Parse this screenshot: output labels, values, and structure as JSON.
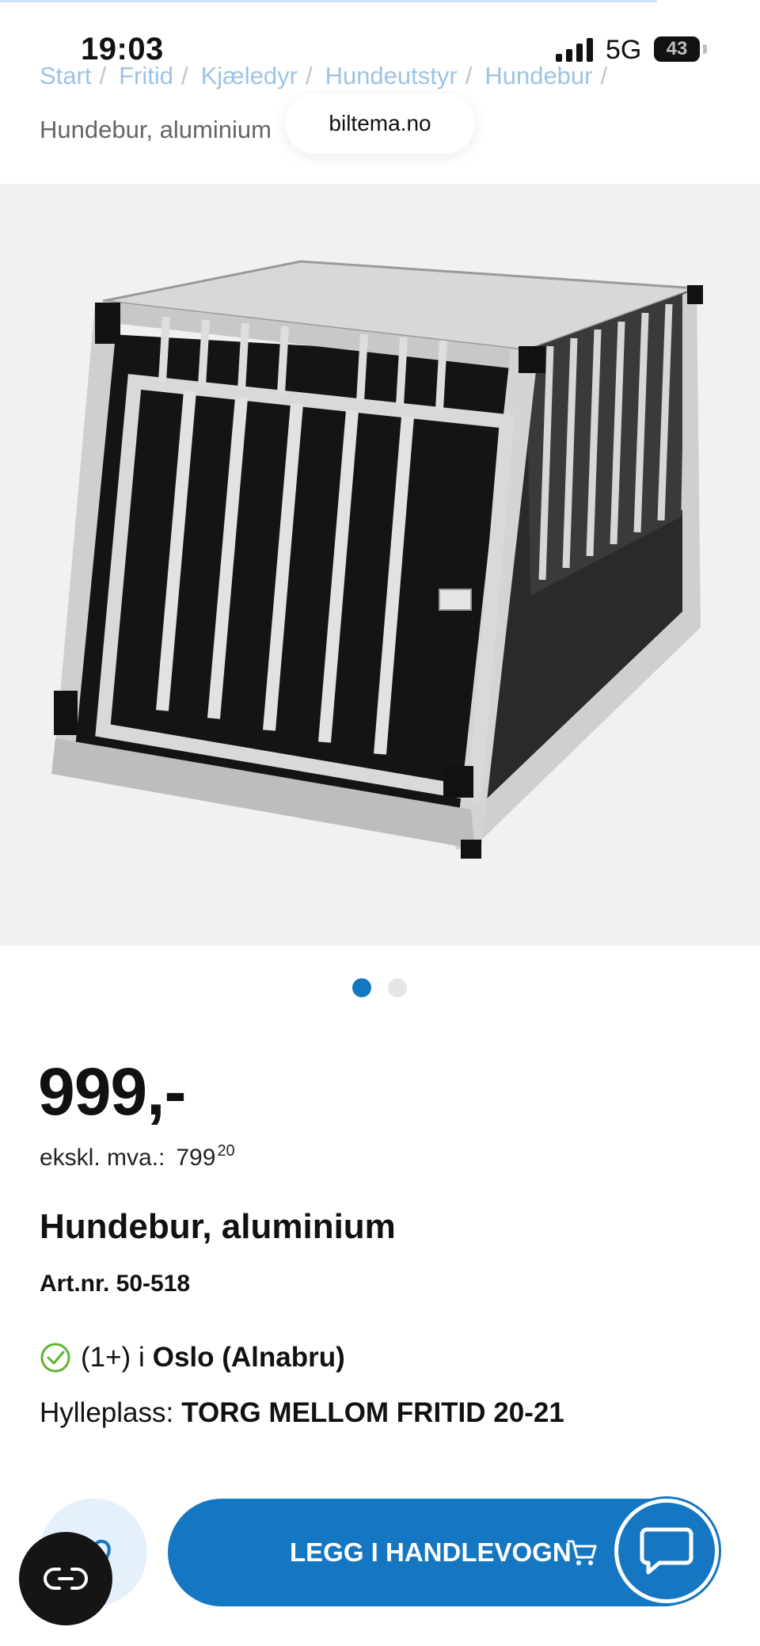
{
  "status_bar": {
    "time": "19:03",
    "network": "5G",
    "battery": "43"
  },
  "browser": {
    "url": "biltema.no"
  },
  "breadcrumb": {
    "items": [
      "Start",
      "Fritid",
      "Kjæledyr",
      "Hundeutstyr",
      "Hundebur"
    ],
    "separator": "/",
    "current": "Hundebur, aluminium"
  },
  "gallery": {
    "image_count": 2,
    "active_index": 1,
    "image_alt": "hundebur-image"
  },
  "product": {
    "price": "999,-",
    "ex_vat_label": "ekskl. mva.:",
    "ex_vat_whole": "799",
    "ex_vat_decimals": "20",
    "title": "Hundebur, aluminium",
    "art_nr": "Art.nr. 50-518",
    "stock_count": "(1+) i",
    "stock_location": "Oslo (Alnabru)",
    "shelf_label": "Hylleplass:",
    "shelf_value": "TORG MELLOM FRITID 20-21"
  },
  "actions": {
    "add_to_cart": "LEGG I HANDLEVOGN"
  },
  "icons": {
    "check": "check-circle-icon",
    "cart": "cart-icon",
    "chat": "chat-icon",
    "cookie": "cookie-consent-icon",
    "favorite": "heart-icon"
  },
  "colors": {
    "primary": "#1577c1",
    "breadcrumb_link": "#9ec3e3",
    "check": "#5cb531",
    "fav_bg": "#e5f0fa"
  }
}
